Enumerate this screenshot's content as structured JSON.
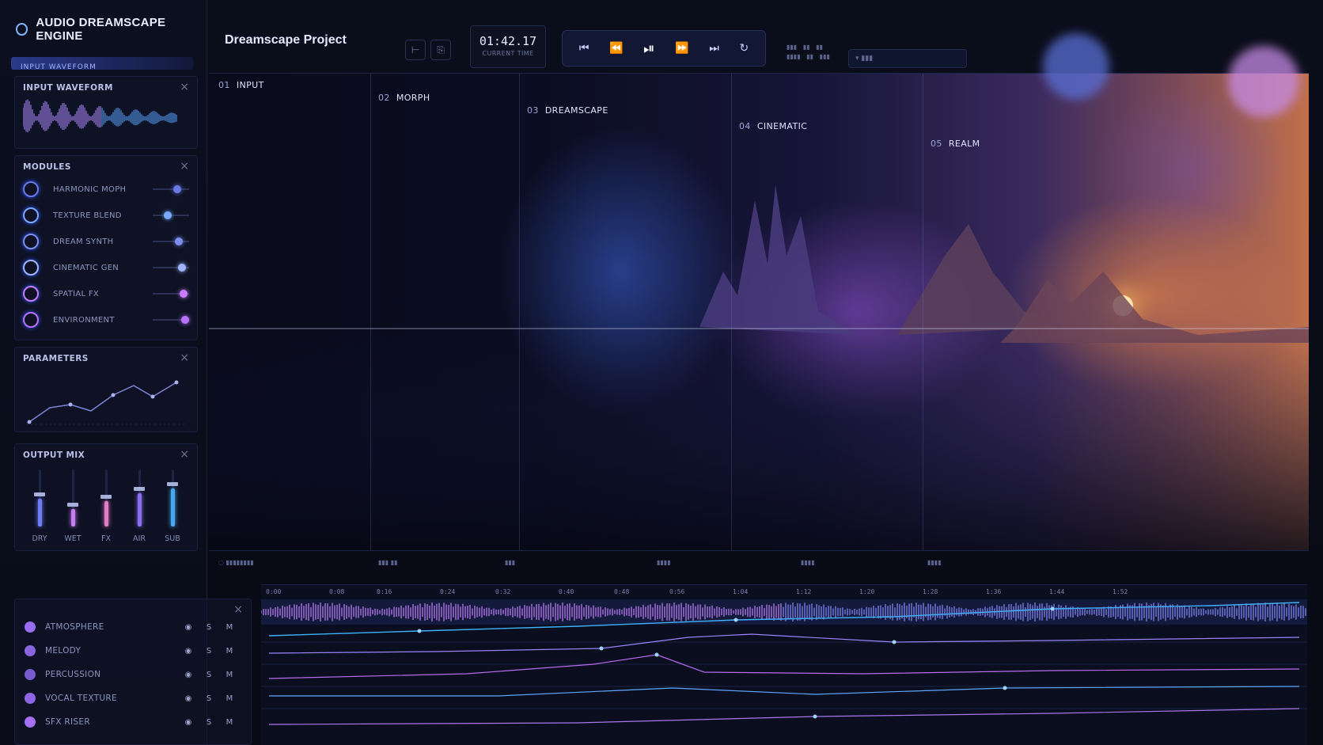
{
  "app": {
    "name": "AUDIO DREAMSCAPE ENGINE",
    "tab_strip_label": "INPUT WAVEFORM"
  },
  "project": {
    "title": "Dreamscape Project"
  },
  "time": {
    "value": "01:42.17",
    "caption": "CURRENT TIME"
  },
  "transport": {
    "rewind": "⏮",
    "prev": "⏪",
    "play_pause": "⏯",
    "forward": "⏩",
    "next": "⏭",
    "loop": "↻"
  },
  "panels": {
    "input_waveform": {
      "title": "INPUT WAVEFORM"
    },
    "modules": {
      "title": "MODULES",
      "items": [
        {
          "label": "HARMONIC MOPH",
          "level": 0.65,
          "color": "#6a79e6"
        },
        {
          "label": "TEXTURE BLEND",
          "level": 0.35,
          "color": "#79a8ff"
        },
        {
          "label": "DREAM SYNTH",
          "level": 0.7,
          "color": "#7c8ff0"
        },
        {
          "label": "CINEMATIC GEN",
          "level": 0.8,
          "color": "#9fb6ff"
        },
        {
          "label": "SPATIAL FX",
          "level": 0.85,
          "color": "#c97cff"
        },
        {
          "label": "ENVIRONMENT",
          "level": 0.9,
          "color": "#b872ff"
        }
      ]
    },
    "parameters": {
      "title": "PARAMETERS"
    },
    "output_mix": {
      "title": "OUTPUT MIX",
      "faders": [
        {
          "label": "DRY",
          "level": 0.55,
          "color": "#6e7df5"
        },
        {
          "label": "WET",
          "level": 0.35,
          "color": "#c77cf2"
        },
        {
          "label": "FX",
          "level": 0.5,
          "color": "#e27bc5"
        },
        {
          "label": "AIR",
          "level": 0.65,
          "color": "#8b6ef0"
        },
        {
          "label": "SUB",
          "level": 0.75,
          "color": "#45a9f0"
        }
      ]
    },
    "tracks": {
      "items": [
        {
          "name": "ATMOSPHERE",
          "color": "#9a6cf0"
        },
        {
          "name": "MELODY",
          "color": "#8a63e0"
        },
        {
          "name": "PERCUSSION",
          "color": "#7a5ad0"
        },
        {
          "name": "VOCAL TEXTURE",
          "color": "#8f65e6"
        },
        {
          "name": "SFX RISER",
          "color": "#a46ff2"
        }
      ],
      "visibility_icon": "eye-icon",
      "solo_label": "S",
      "mute_label": "M"
    }
  },
  "sections": [
    {
      "num": "01",
      "label": "INPUT"
    },
    {
      "num": "02",
      "label": "MORPH"
    },
    {
      "num": "03",
      "label": "DREAMSCAPE"
    },
    {
      "num": "04",
      "label": "CINEMATIC"
    },
    {
      "num": "05",
      "label": "REALM"
    }
  ],
  "colors": {
    "accent": "#7a8cff",
    "purple": "#b57cff",
    "orange": "#ff9a4a"
  }
}
